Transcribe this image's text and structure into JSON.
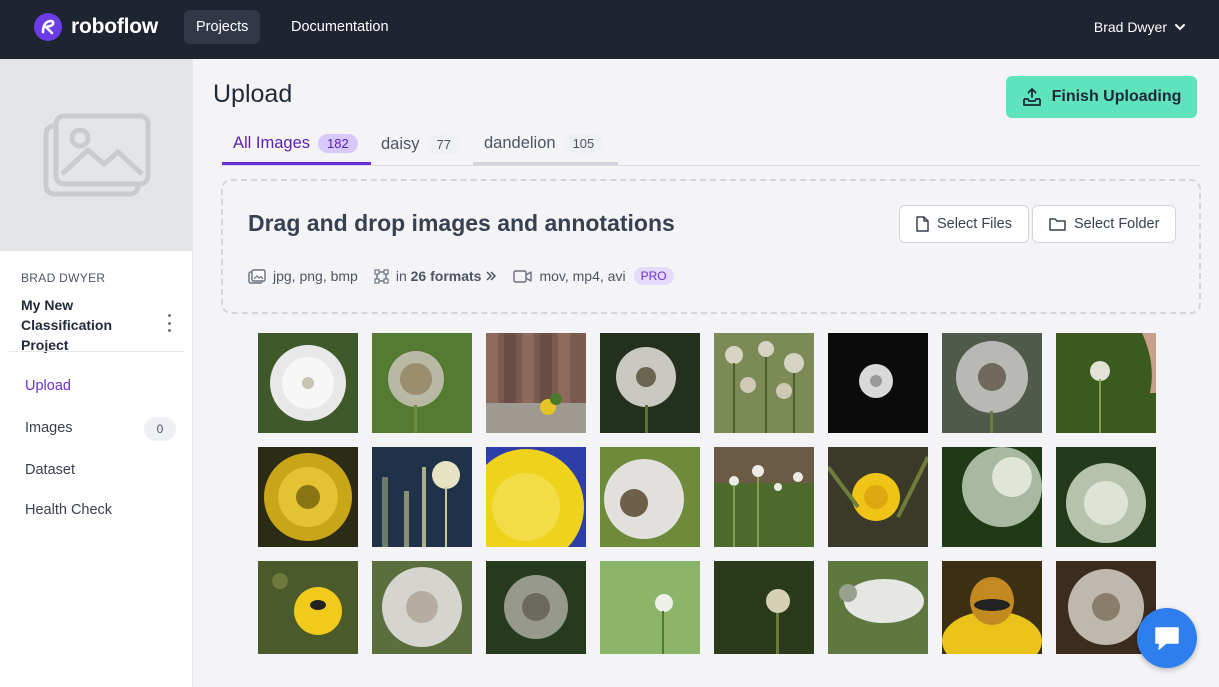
{
  "brand": {
    "name": "roboflow"
  },
  "nav": {
    "projects": "Projects",
    "documentation": "Documentation",
    "user": "Brad Dwyer"
  },
  "sidebar": {
    "owner": "BRAD DWYER",
    "project_name": "My New Classification Project",
    "items": [
      {
        "label": "Upload",
        "active": true
      },
      {
        "label": "Images",
        "count": "0"
      },
      {
        "label": "Dataset"
      },
      {
        "label": "Health Check"
      }
    ]
  },
  "main": {
    "title": "Upload",
    "finish_button": "Finish Uploading",
    "tabs": [
      {
        "label": "All Images",
        "count": "182"
      },
      {
        "label": "daisy",
        "count": "77"
      },
      {
        "label": "dandelion",
        "count": "105"
      }
    ],
    "dropzone": {
      "title": "Drag and drop images and annotations",
      "select_files": "Select Files",
      "select_folder": "Select Folder",
      "image_formats": "jpg, png, bmp",
      "annotation_prefix": "in",
      "annotation_formats": "26 formats",
      "video_formats": "mov, mp4, avi",
      "pro_badge": "PRO"
    }
  },
  "images": [
    {
      "name": "dandelion-seedhead-1"
    },
    {
      "name": "dandelion-seedhead-2"
    },
    {
      "name": "dandelion-by-fence"
    },
    {
      "name": "dandelion-seedhead-3"
    },
    {
      "name": "dandelions-field"
    },
    {
      "name": "dandelion-dark"
    },
    {
      "name": "dandelion-seedhead-4"
    },
    {
      "name": "dandelion-blowing"
    },
    {
      "name": "dandelion-yellow-1"
    },
    {
      "name": "dandelion-blue-tint"
    },
    {
      "name": "dandelion-yellow-2"
    },
    {
      "name": "dandelion-seedhead-5"
    },
    {
      "name": "dandelions-meadow"
    },
    {
      "name": "dandelion-yellow-3"
    },
    {
      "name": "dandelion-seeds-1"
    },
    {
      "name": "dandelion-seeds-2"
    },
    {
      "name": "dandelion-with-bee"
    },
    {
      "name": "dandelion-seedhead-6"
    },
    {
      "name": "dandelion-seedhead-7"
    },
    {
      "name": "dandelion-green-bg"
    },
    {
      "name": "dandelion-bud"
    },
    {
      "name": "dandelion-wind"
    },
    {
      "name": "bumblebee-on-dandelion"
    },
    {
      "name": "dandelion-seedhead-8"
    }
  ],
  "colors": {
    "accent": "#6a2fd6",
    "finish": "#5ee3bc",
    "nav_bg": "#1f2431",
    "chat": "#2f7ef0"
  }
}
